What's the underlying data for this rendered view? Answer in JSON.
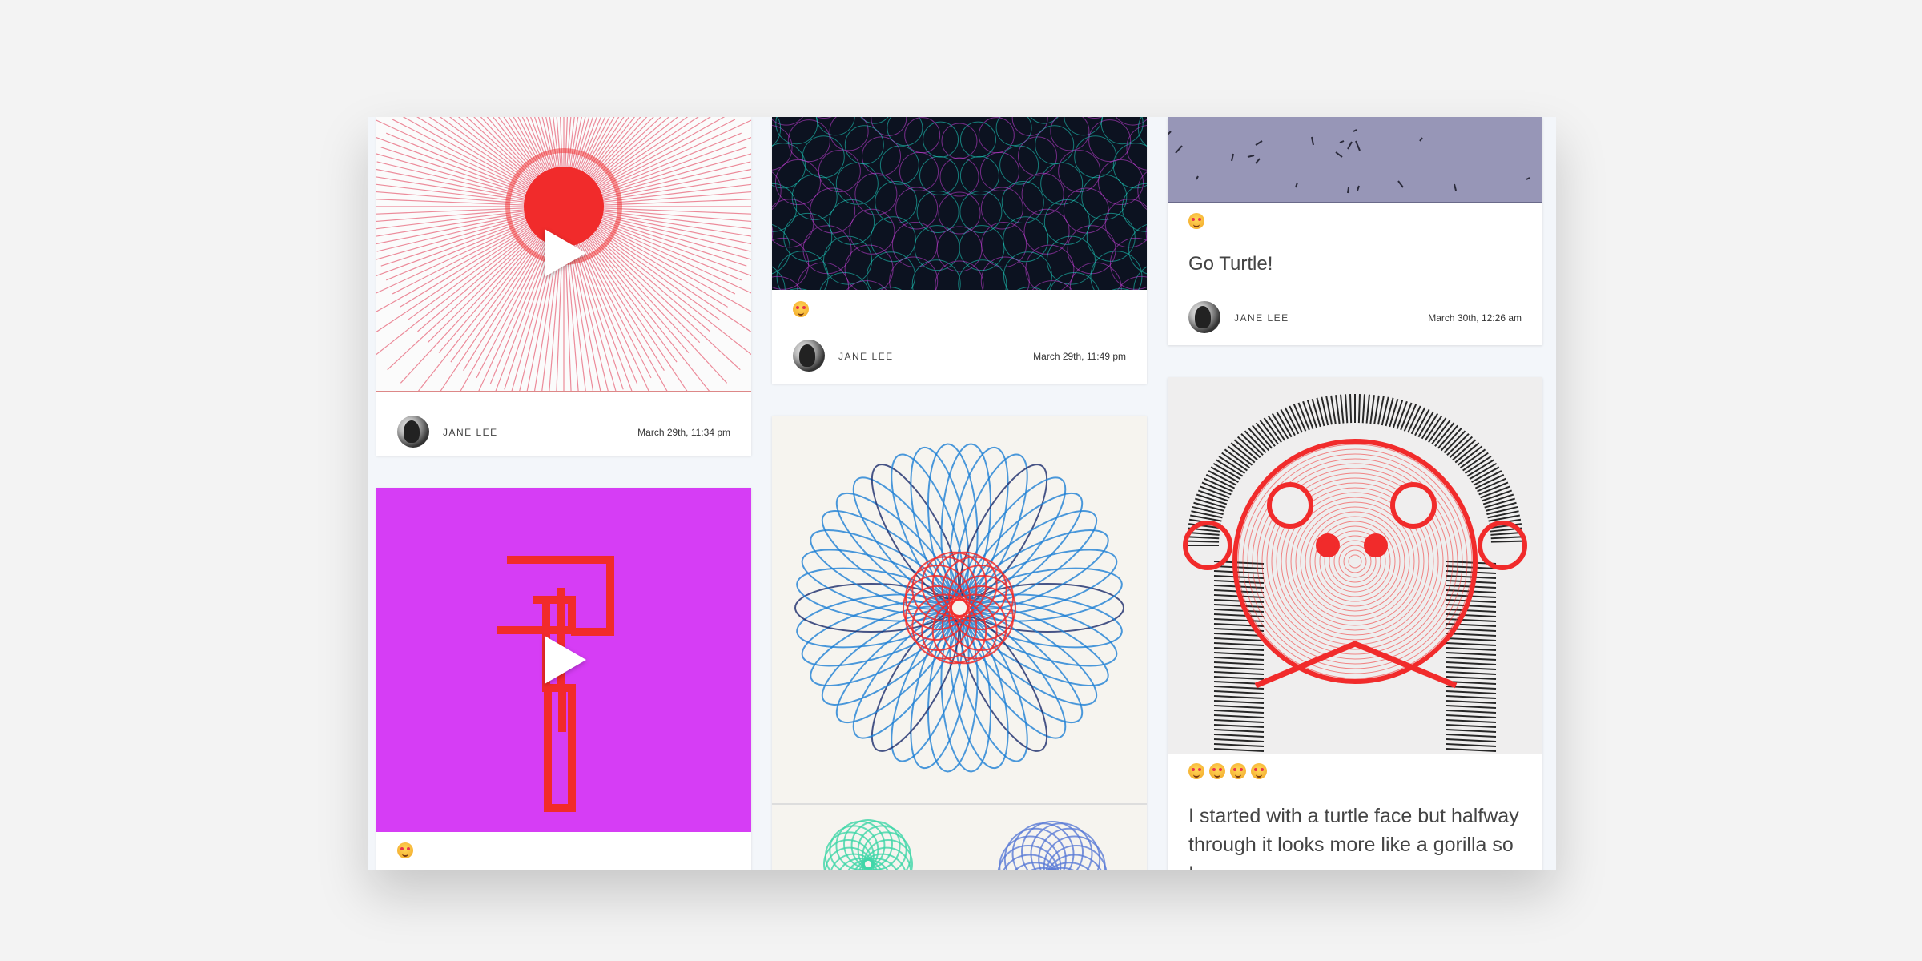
{
  "author": "JANE LEE",
  "cards": {
    "c1": {
      "date": "March 29th, 11:34 pm"
    },
    "c2": {
      "emoji_count": 1
    },
    "c3": {
      "date": "March 29th, 11:49 pm",
      "emoji_count": 1
    },
    "c4": {},
    "c5": {
      "title": "Go Turtle!",
      "date": "March 30th, 12:26 am",
      "emoji_count": 1
    },
    "c6": {
      "text": "I started with a turtle face but halfway through it looks more like a gorilla so I",
      "emoji_count": 4
    }
  },
  "colors": {
    "purple_bg": "#d63df5",
    "lavender_bg": "#9796b7",
    "red": "#f12b2b",
    "blue": "#1e7fd4"
  },
  "icons": [
    "play-icon",
    "heart-eyes-emoji-icon",
    "avatar"
  ]
}
